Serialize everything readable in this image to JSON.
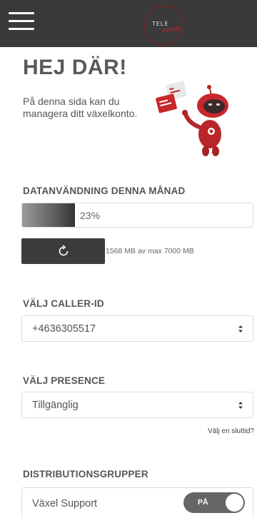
{
  "header": {
    "logo_text_top": "TELE",
    "logo_text_script": "Profile",
    "menu_icon": "hamburger-menu-icon"
  },
  "greeting": {
    "title": "HEJ DÄR!",
    "description": "På denna sida kan du managera ditt växelkonto."
  },
  "data_usage": {
    "title": "DATANVÄNDNING DENNA MÅNAD",
    "percent_label": "23%",
    "percent_value": 0.23,
    "refresh_icon": "refresh-icon",
    "usage_text": "1568 MB av max 7000 MB"
  },
  "caller_id": {
    "title": "VÄLJ CALLER-ID",
    "selected": "+4636305517"
  },
  "presence": {
    "title": "VÄLJ PRESENCE",
    "selected": "Tillgänglig",
    "end_time_link": "Välj en sluttid?"
  },
  "distribution_groups": {
    "title": "DISTRIBUTIONSGRUPPER",
    "items": [
      {
        "label": "Växel Support",
        "toggle_label": "PÅ",
        "enabled": true
      }
    ]
  },
  "colors": {
    "topbar": "#3a3a3a",
    "accent_red": "#c8282c",
    "button_dark": "#3c3c3c",
    "toggle_on": "#666666"
  }
}
